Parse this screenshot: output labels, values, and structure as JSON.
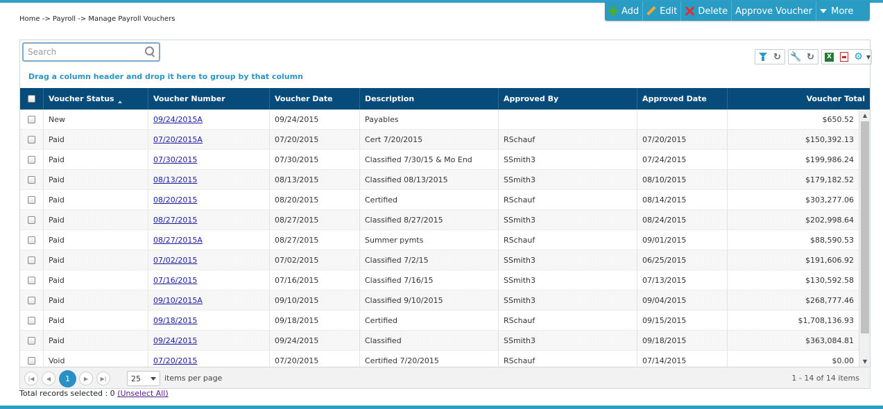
{
  "breadcrumb": "Home -> Payroll -> Manage Payroll Vouchers",
  "toolbar": {
    "add": "Add",
    "edit": "Edit",
    "delete": "Delete",
    "approve": "Approve Voucher",
    "more": "More"
  },
  "search": {
    "placeholder": "Search",
    "value": ""
  },
  "group_hint": "Drag a column header and drop it here to group by that column",
  "columns": {
    "status": "Voucher Status",
    "number": "Voucher Number",
    "date": "Voucher Date",
    "description": "Description",
    "approved_by": "Approved By",
    "approved_date": "Approved Date",
    "total": "Voucher Total"
  },
  "rows": [
    {
      "status": "New",
      "number": "09/24/2015A",
      "date": "09/24/2015",
      "description": "Payables",
      "approved_by": "",
      "approved_date": "",
      "total": "$650.52"
    },
    {
      "status": "Paid",
      "number": "07/20/2015A",
      "date": "07/20/2015",
      "description": "Cert 7/20/2015",
      "approved_by": "RSchauf",
      "approved_date": "07/20/2015",
      "total": "$150,392.13"
    },
    {
      "status": "Paid",
      "number": "07/30/2015",
      "date": "07/30/2015",
      "description": "Classified 7/30/15 & Mo End",
      "approved_by": "SSmith3",
      "approved_date": "07/24/2015",
      "total": "$199,986.24"
    },
    {
      "status": "Paid",
      "number": "08/13/2015",
      "date": "08/13/2015",
      "description": "Classified 08/13/2015",
      "approved_by": "SSmith3",
      "approved_date": "08/10/2015",
      "total": "$179,182.52"
    },
    {
      "status": "Paid",
      "number": "08/20/2015",
      "date": "08/20/2015",
      "description": "Certified",
      "approved_by": "RSchauf",
      "approved_date": "08/14/2015",
      "total": "$303,277.06"
    },
    {
      "status": "Paid",
      "number": "08/27/2015",
      "date": "08/27/2015",
      "description": "Classified 8/27/2015",
      "approved_by": "SSmith3",
      "approved_date": "08/24/2015",
      "total": "$202,998.64"
    },
    {
      "status": "Paid",
      "number": "08/27/2015A",
      "date": "08/27/2015",
      "description": "Summer pymts",
      "approved_by": "RSchauf",
      "approved_date": "09/01/2015",
      "total": "$88,590.53"
    },
    {
      "status": "Paid",
      "number": "07/02/2015",
      "date": "07/02/2015",
      "description": "Classified 7/2/15",
      "approved_by": "SSmith3",
      "approved_date": "06/25/2015",
      "total": "$191,606.92"
    },
    {
      "status": "Paid",
      "number": "07/16/2015",
      "date": "07/16/2015",
      "description": "Classified 7/16/15",
      "approved_by": "SSmith3",
      "approved_date": "07/13/2015",
      "total": "$130,592.58"
    },
    {
      "status": "Paid",
      "number": "09/10/2015A",
      "date": "09/10/2015",
      "description": "Classified 9/10/2015",
      "approved_by": "SSmith3",
      "approved_date": "09/04/2015",
      "total": "$268,777.46"
    },
    {
      "status": "Paid",
      "number": "09/18/2015",
      "date": "09/18/2015",
      "description": "Certified",
      "approved_by": "RSchauf",
      "approved_date": "09/15/2015",
      "total": "$1,708,136.93"
    },
    {
      "status": "Paid",
      "number": "09/24/2015",
      "date": "09/24/2015",
      "description": "Classified",
      "approved_by": "SSmith3",
      "approved_date": "09/18/2015",
      "total": "$363,084.81"
    },
    {
      "status": "Void",
      "number": "07/20/2015",
      "date": "07/20/2015",
      "description": "Certified 7/20/2015",
      "approved_by": "RSchauf",
      "approved_date": "07/14/2015",
      "total": "$0.00"
    }
  ],
  "pager": {
    "current_page": "1",
    "page_size": "25",
    "items_per_page_label": "items per page",
    "info": "1 - 14 of 14 items"
  },
  "footer": {
    "total_selected": "Total records selected : 0",
    "unselect_all": "(Unselect All)"
  },
  "colors": {
    "accent": "#2a9cc4",
    "header_bg": "#074b7b",
    "link": "#1a1aa6"
  }
}
